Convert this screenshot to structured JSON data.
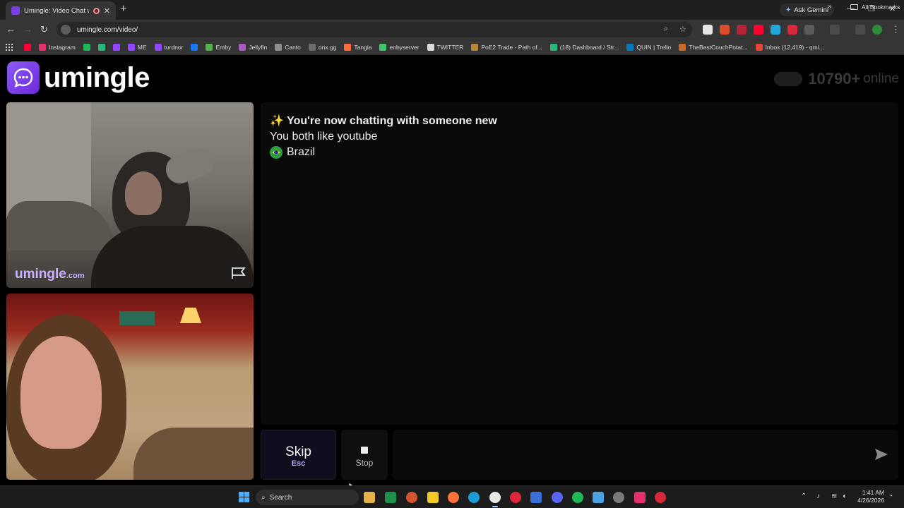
{
  "browser": {
    "tab_title": "Umingle: Video Chat with S",
    "ask_gemini": "Ask Gemini",
    "url": "umingle.com/video/",
    "all_bookmarks": "All Bookmarks",
    "bookmarks": [
      {
        "label": "",
        "color": "#ff0033"
      },
      {
        "label": "Instagram",
        "color": "#e1306c"
      },
      {
        "label": "",
        "color": "#1db954"
      },
      {
        "label": "",
        "color": "#2db67c"
      },
      {
        "label": "",
        "color": "#9146ff"
      },
      {
        "label": "ME",
        "color": "#9146ff"
      },
      {
        "label": "turdnor",
        "color": "#9146ff"
      },
      {
        "label": "",
        "color": "#1877f2"
      },
      {
        "label": "Emby",
        "color": "#52b54b"
      },
      {
        "label": "Jellyfin",
        "color": "#aa5cc3"
      },
      {
        "label": "Canto",
        "color": "#8d8d8d"
      },
      {
        "label": "onx.gg",
        "color": "#6c6c6c"
      },
      {
        "label": "Tangia",
        "color": "#ff6a3d"
      },
      {
        "label": "enbyserver",
        "color": "#3ec46d"
      },
      {
        "label": "TWITTER",
        "color": "#dcdcdc"
      },
      {
        "label": "PoE2 Trade - Path of...",
        "color": "#b8863b"
      },
      {
        "label": "(18) Dashboard / Str...",
        "color": "#2db67c"
      },
      {
        "label": "QUIN | Trello",
        "color": "#0079bf"
      },
      {
        "label": "TheBestCouchPotat...",
        "color": "#c86b2a"
      },
      {
        "label": "Inbox (12,419) - qmi...",
        "color": "#ea4335"
      }
    ]
  },
  "site": {
    "logo_text": "umingle",
    "online_count": "10790+",
    "online_label": "online",
    "watermark": "umingle",
    "watermark_suffix": ".com",
    "chat": {
      "sparkle": "✨",
      "title": "You're now chatting with someone new",
      "common_interest": "You both like youtube",
      "country": "Brazil"
    },
    "skip_label": "Skip",
    "skip_key": "Esc",
    "stop_label": "Stop",
    "accent_color": "#8b5cf6"
  },
  "taskbar": {
    "search_label": "Search",
    "time": "1:41 AM",
    "date": "4/26/2026"
  }
}
